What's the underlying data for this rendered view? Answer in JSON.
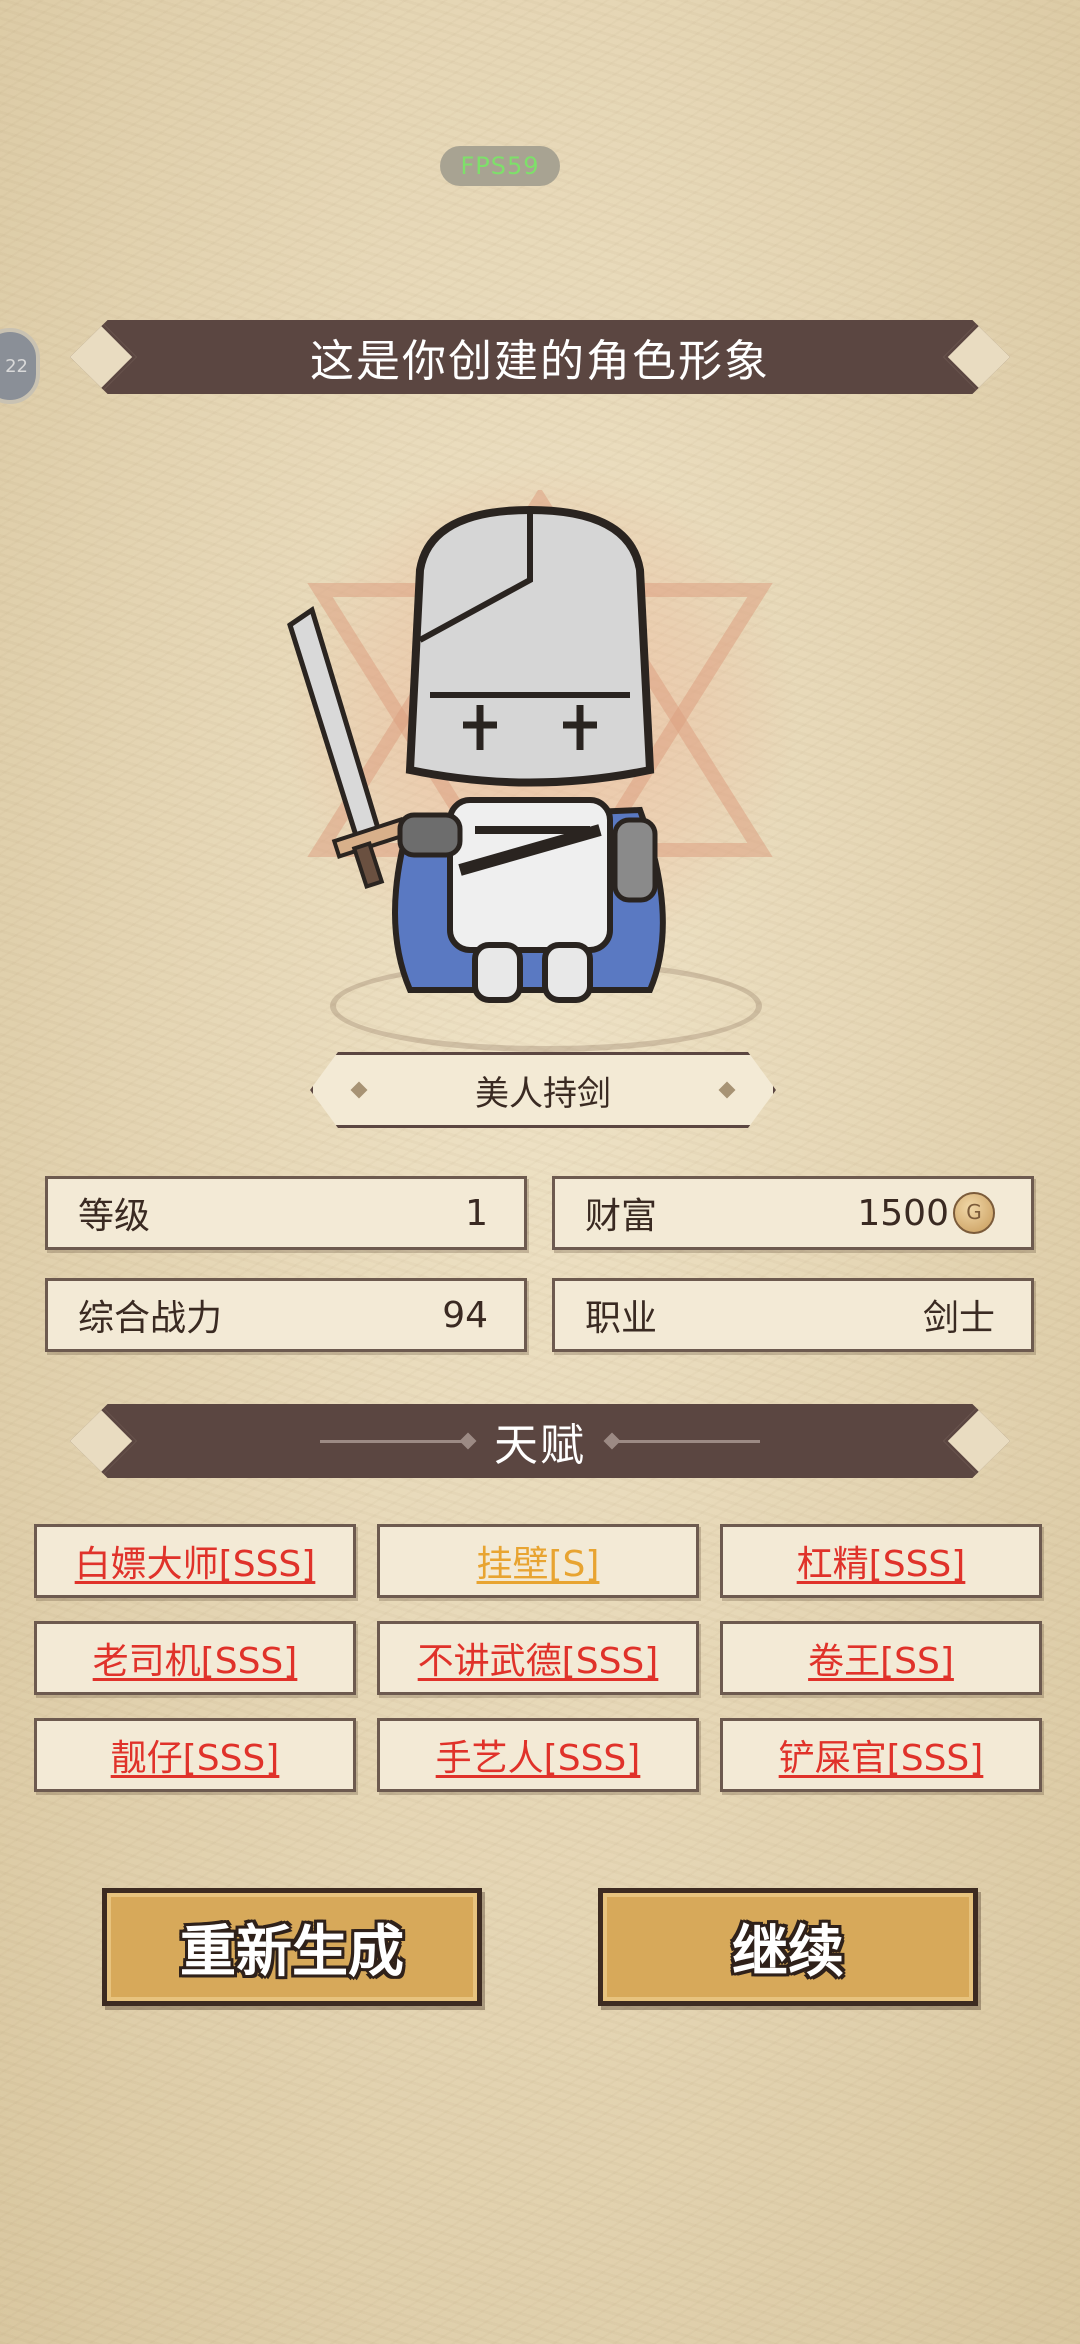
{
  "status": {
    "fps": "FPS59",
    "side_badge": "22"
  },
  "header": {
    "title": "这是你创建的角色形象"
  },
  "character": {
    "name": "美人持剑"
  },
  "stats": [
    {
      "label": "等级",
      "value": "1"
    },
    {
      "label": "财富",
      "value": "1500",
      "icon": "gold-coin-icon"
    },
    {
      "label": "综合战力",
      "value": "94"
    },
    {
      "label": "职业",
      "value": "剑士"
    }
  ],
  "talents_section": {
    "title": "天赋"
  },
  "talents": [
    {
      "label": "白嫖大师[SSS]",
      "color": "#e0322a"
    },
    {
      "label": "挂壁[S]",
      "color": "#e8a431"
    },
    {
      "label": "杠精[SSS]",
      "color": "#e0322a"
    },
    {
      "label": "老司机[SSS]",
      "color": "#e0322a"
    },
    {
      "label": "不讲武德[SSS]",
      "color": "#e0322a"
    },
    {
      "label": "卷王[SS]",
      "color": "#e0322a"
    },
    {
      "label": "靓仔[SSS]",
      "color": "#e0322a"
    },
    {
      "label": "手艺人[SSS]",
      "color": "#e0322a"
    },
    {
      "label": "铲屎官[SSS]",
      "color": "#e0322a"
    }
  ],
  "actions": {
    "regenerate": "重新生成",
    "continue": "继续"
  },
  "colors": {
    "banner": "#5b4641",
    "button": "#d7a95a",
    "talent_red": "#e0322a",
    "talent_gold": "#e8a431"
  }
}
